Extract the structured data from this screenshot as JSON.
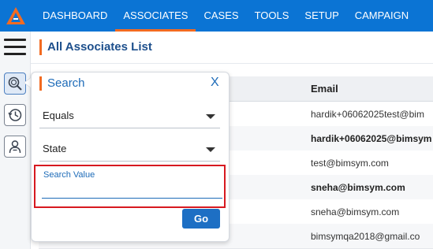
{
  "nav": {
    "items": [
      "DASHBOARD",
      "ASSOCIATES",
      "CASES",
      "TOOLS",
      "SETUP",
      "CAMPAIGN"
    ],
    "active": "ASSOCIATES"
  },
  "page": {
    "title": "All Associates List"
  },
  "table": {
    "column_header": "Email",
    "rows": [
      {
        "email": "hardik+06062025test@bim"
      },
      {
        "email": "hardik+06062025@bimsym"
      },
      {
        "email": "test@bimsym.com"
      },
      {
        "email": "sneha@bimsym.com"
      },
      {
        "email": "sneha@bimsym.com"
      },
      {
        "email": "bimsymqa2018@gmail.co"
      }
    ]
  },
  "search_panel": {
    "title": "Search",
    "close_label": "X",
    "operator": "Equals",
    "field": "State",
    "value_label": "Search Value",
    "value": "",
    "go_label": "Go"
  },
  "colors": {
    "nav_bg": "#0b74d4",
    "accent": "#f26b21",
    "highlight": "#d71920"
  },
  "icons": [
    "logo-icon",
    "hamburger-icon",
    "search-icon",
    "history-icon",
    "contacts-icon",
    "chevron-down-icon"
  ]
}
